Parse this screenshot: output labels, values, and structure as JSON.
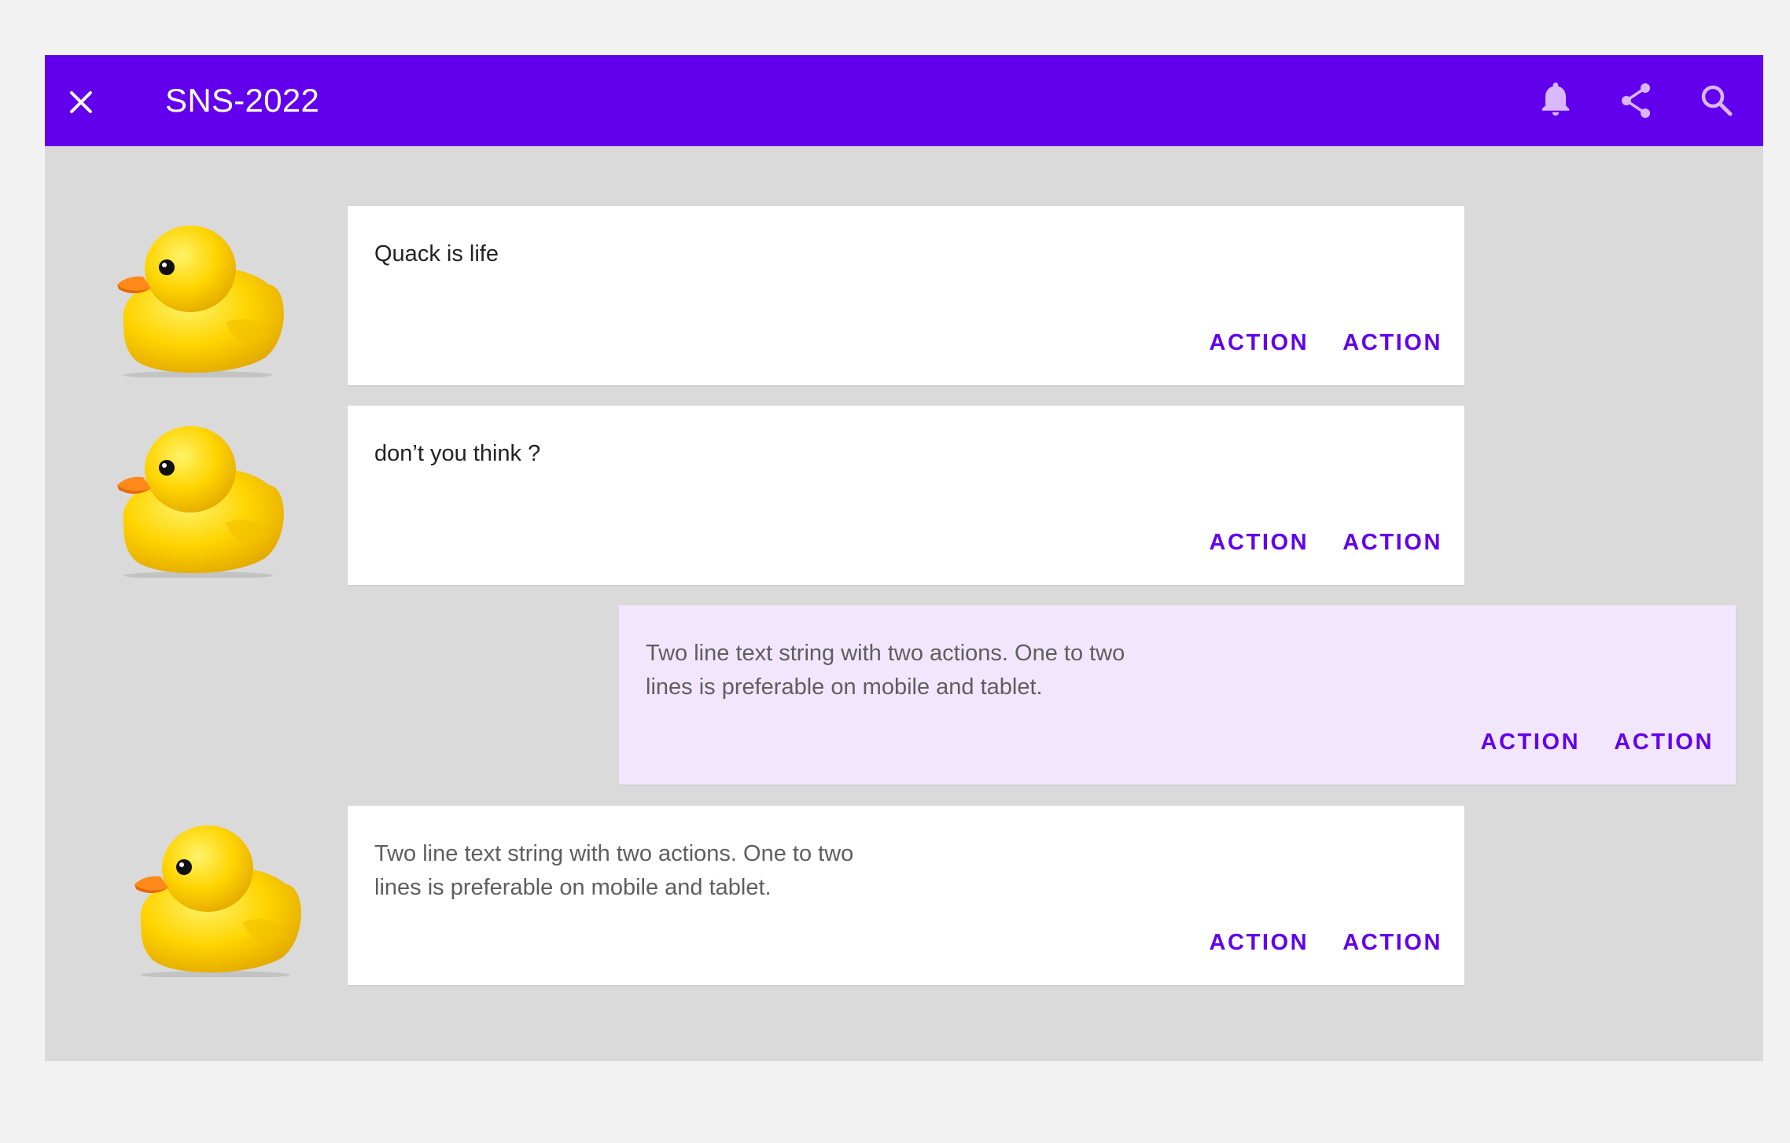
{
  "appbar": {
    "title": "SNS-2022",
    "icons": [
      "close-icon",
      "bell-icon",
      "share-icon",
      "search-icon"
    ],
    "color": "#6200ee"
  },
  "messages": [
    {
      "text": "Quack is life",
      "own": false,
      "avatar": "rubber-duck",
      "actions": [
        "ACTION",
        "ACTION"
      ]
    },
    {
      "text": "don’t you think ?",
      "own": false,
      "avatar": "rubber-duck",
      "actions": [
        "ACTION",
        "ACTION"
      ]
    },
    {
      "text": "Two line text string with two actions. One to two\nlines is preferable on mobile and tablet.",
      "own": true,
      "avatar": "",
      "actions": [
        "ACTION",
        "ACTION"
      ]
    },
    {
      "text": "Two line text string with two actions. One to two\nlines is preferable on mobile and tablet.",
      "own": false,
      "avatar": "rubber-duck",
      "actions": [
        "ACTION",
        "ACTION"
      ]
    }
  ],
  "colors": {
    "accent": "#6200ee",
    "own_bubble": "#f2e6fd",
    "background": "#dadada"
  }
}
